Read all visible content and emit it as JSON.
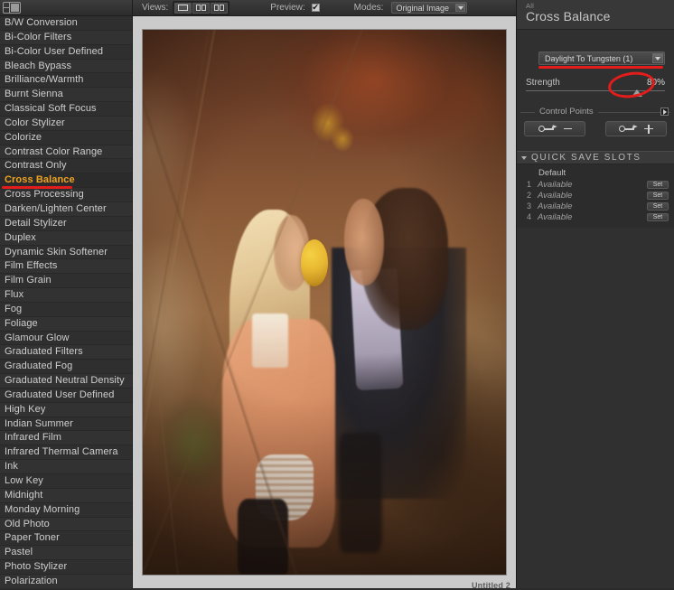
{
  "toolbar": {
    "views_label": "Views:",
    "preview_label": "Preview:",
    "preview_checked": "✔",
    "modes_label": "Modes:",
    "modes_value": "Original Image",
    "view_buttons": [
      "single-view",
      "split-view",
      "side-by-side-view"
    ]
  },
  "filters": {
    "items": [
      "B/W Conversion",
      "Bi-Color Filters",
      "Bi-Color User Defined",
      "Bleach Bypass",
      "Brilliance/Warmth",
      "Burnt Sienna",
      "Classical Soft Focus",
      "Color Stylizer",
      "Colorize",
      "Contrast Color Range",
      "Contrast Only",
      "Cross Balance",
      "Cross Processing",
      "Darken/Lighten Center",
      "Detail Stylizer",
      "Duplex",
      "Dynamic Skin Softener",
      "Film Effects",
      "Film Grain",
      "Flux",
      "Fog",
      "Foliage",
      "Glamour Glow",
      "Graduated Filters",
      "Graduated Fog",
      "Graduated Neutral Density",
      "Graduated User Defined",
      "High Key",
      "Indian Summer",
      "Infrared Film",
      "Infrared Thermal Camera",
      "Ink",
      "Low Key",
      "Midnight",
      "Monday Morning",
      "Old Photo",
      "Paper Toner",
      "Pastel",
      "Photo Stylizer",
      "Polarization"
    ],
    "selected": "Cross Balance",
    "selected_index": 11,
    "selected_color": "#f0a320"
  },
  "canvas": {
    "document_label": "Untitled 2"
  },
  "panel": {
    "scope_label": "All",
    "title": "Cross Balance",
    "preset": {
      "value": "Daylight To Tungsten (1)"
    },
    "strength": {
      "label": "Strength",
      "value": "80%",
      "percent": 80
    },
    "control_points": {
      "label": "Control Points",
      "remove_button": "remove-control-point",
      "add_button": "add-control-point"
    },
    "quick_save_slots": {
      "title": "QUICK SAVE SLOTS",
      "default_label": "Default",
      "set_label": "Set",
      "slots": [
        {
          "num": "1",
          "status": "Available"
        },
        {
          "num": "2",
          "status": "Available"
        },
        {
          "num": "3",
          "status": "Available"
        },
        {
          "num": "4",
          "status": "Available"
        }
      ]
    }
  },
  "annotations": {
    "color": "#e31c1c",
    "underline_filter": "Cross Balance",
    "underline_preset": "Daylight To Tungsten (1)",
    "ellipse_target": "80%"
  }
}
